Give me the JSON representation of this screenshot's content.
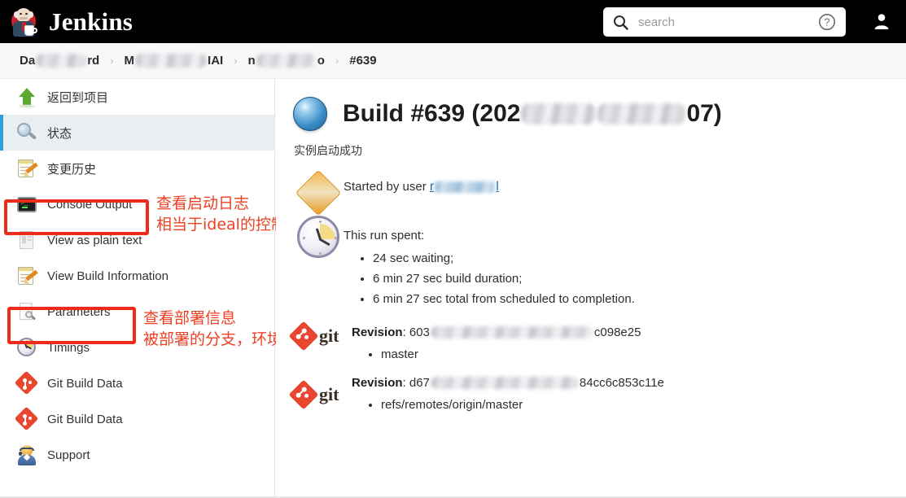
{
  "topbar": {
    "brand": "Jenkins",
    "logo_icon": "jenkins-butler-icon",
    "search": {
      "placeholder": "search",
      "value": "",
      "icon": "search-icon"
    },
    "help_icon": "help-circle-icon",
    "user_icon": "user-account-icon"
  },
  "breadcrumb": {
    "items": [
      {
        "prefix": "Da",
        "redacted": true,
        "suffix": "rd",
        "redact_width": 62
      },
      {
        "prefix": "M",
        "redacted": true,
        "suffix": "IAI",
        "redact_width": 88
      },
      {
        "prefix": "n",
        "redacted": true,
        "suffix": "o",
        "redact_width": 74
      },
      {
        "prefix": "#639",
        "redacted": false,
        "suffix": "",
        "redact_width": 0
      }
    ],
    "separator": "›"
  },
  "sidebar": {
    "items": [
      {
        "label": "返回到项目",
        "icon": "up-arrow-icon",
        "selected": false,
        "cjk": true
      },
      {
        "label": "状态",
        "icon": "magnifier-icon",
        "selected": true,
        "cjk": true
      },
      {
        "label": "变更历史",
        "icon": "notepad-pencil-icon",
        "selected": false,
        "cjk": true
      },
      {
        "label": "Console Output",
        "icon": "terminal-icon",
        "selected": false,
        "cjk": false
      },
      {
        "label": "View as plain text",
        "icon": "plain-page-icon",
        "selected": false,
        "cjk": false
      },
      {
        "label": "View Build Information",
        "icon": "notepad-pencil-icon",
        "selected": false,
        "cjk": false
      },
      {
        "label": "Parameters",
        "icon": "document-magnifier-icon",
        "selected": false,
        "cjk": false
      },
      {
        "label": "Timings",
        "icon": "clock-icon",
        "selected": false,
        "cjk": false
      },
      {
        "label": "Git Build Data",
        "icon": "git-icon",
        "selected": false,
        "cjk": false
      },
      {
        "label": "Git Build Data",
        "icon": "git-icon",
        "selected": false,
        "cjk": false
      },
      {
        "label": "Support",
        "icon": "support-agent-icon",
        "selected": false,
        "cjk": false
      }
    ]
  },
  "annotations": {
    "accent_color": "#ee4023",
    "box_color": "#ee2b1a",
    "console": {
      "line1": "查看启动日志",
      "line2": "相当于ideal的控制台"
    },
    "parameters": {
      "line1": "查看部署信息",
      "line2": "被部署的分支，环境等"
    }
  },
  "main": {
    "status_icon": "blue-ball-status-icon",
    "title_prefix": "Build #639 (202",
    "title_suffix": "07)",
    "title_redact_1_width": 92,
    "title_redact_2_width": 108,
    "description": "实例启动成功",
    "started_by": {
      "icon": "user-diamond-icon",
      "text": "Started by user ",
      "user_prefix": "r",
      "user_suffix": "l",
      "user_redact_width": 74
    },
    "timings": {
      "icon": "clock-icon",
      "heading": "This run spent:",
      "items": [
        "24 sec waiting;",
        "6 min 27 sec build duration;",
        "6 min 27 sec total from scheduled to completion."
      ]
    },
    "revisions": [
      {
        "icon": "git-logo",
        "logo_text": "git",
        "label": "Revision",
        "sha_prefix": "603",
        "sha_suffix": "c098e25",
        "sha_redact_width": 200,
        "refs": [
          "master"
        ]
      },
      {
        "icon": "git-logo",
        "logo_text": "git",
        "label": "Revision",
        "sha_prefix": "d67",
        "sha_suffix": "84cc6c853c11e",
        "sha_redact_width": 182,
        "refs": [
          "refs/remotes/origin/master"
        ]
      }
    ]
  }
}
